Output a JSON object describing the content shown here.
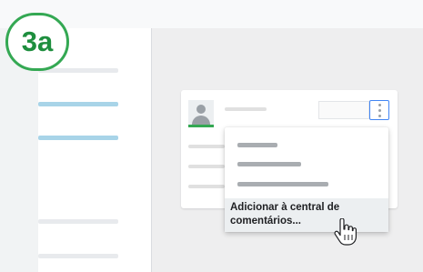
{
  "step": {
    "label": "3a"
  },
  "menu": {
    "highlighted_item_label": "Adicionar à central de comentários..."
  },
  "colors": {
    "accent_green": "#34a853",
    "sidebar_highlight": "#a8d4e8",
    "focus_blue": "#4285f4"
  },
  "icons": {
    "avatar": "person-avatar-icon",
    "more": "more-vert-icon",
    "cursor": "hand-pointer-icon"
  }
}
